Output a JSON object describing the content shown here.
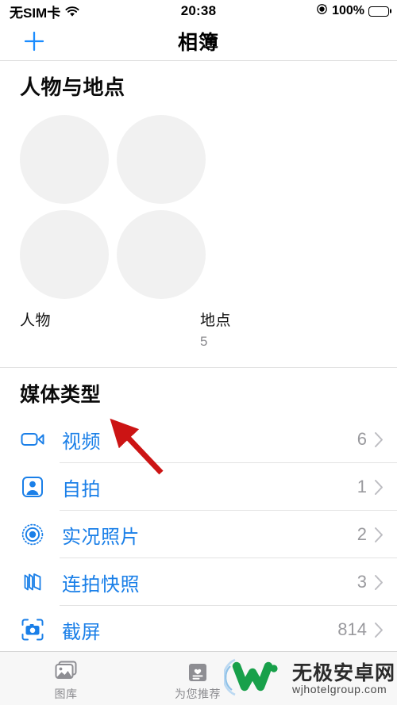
{
  "status_bar": {
    "carrier": "无SIM卡",
    "wifi_icon": "wifi-icon",
    "time": "20:38",
    "rotation_lock_icon": "rotation-lock-icon",
    "battery_percent": "100%",
    "battery_icon": "battery-full-icon"
  },
  "nav_bar": {
    "add_icon": "plus-icon",
    "title": "相簿"
  },
  "people_places": {
    "title": "人物与地点",
    "items": [
      {
        "label": "人物",
        "count": ""
      },
      {
        "label": "地点",
        "count": "5"
      }
    ]
  },
  "media_types": {
    "title": "媒体类型",
    "rows": [
      {
        "icon": "video-camera-icon",
        "label": "视频",
        "count": "6",
        "chevron": "chevron-right-icon"
      },
      {
        "icon": "selfie-person-icon",
        "label": "自拍",
        "count": "1",
        "chevron": "chevron-right-icon"
      },
      {
        "icon": "live-photo-icon",
        "label": "实况照片",
        "count": "2",
        "chevron": "chevron-right-icon"
      },
      {
        "icon": "burst-stack-icon",
        "label": "连拍快照",
        "count": "3",
        "chevron": "chevron-right-icon"
      },
      {
        "icon": "screenshot-icon",
        "label": "截屏",
        "count": "814",
        "chevron": "chevron-right-icon"
      }
    ]
  },
  "annotation": {
    "arrow_color": "#cc1414",
    "arrow_points_at": "视频"
  },
  "tab_bar": {
    "tabs": [
      {
        "icon": "photos-library-icon",
        "label": "图库"
      },
      {
        "icon": "for-you-card-icon",
        "label": "为您推荐"
      }
    ]
  },
  "watermark": {
    "logo_icon": "w-logo-icon",
    "site_name": "无极安卓网",
    "site_url": "wjhotelgroup.com",
    "logo_color": "#18a04a"
  },
  "colors": {
    "accent_blue": "#1a7fe8",
    "nav_blue": "#1a8cff",
    "count_gray": "#9a9a9e",
    "placeholder_gray": "#f1f1f1"
  }
}
